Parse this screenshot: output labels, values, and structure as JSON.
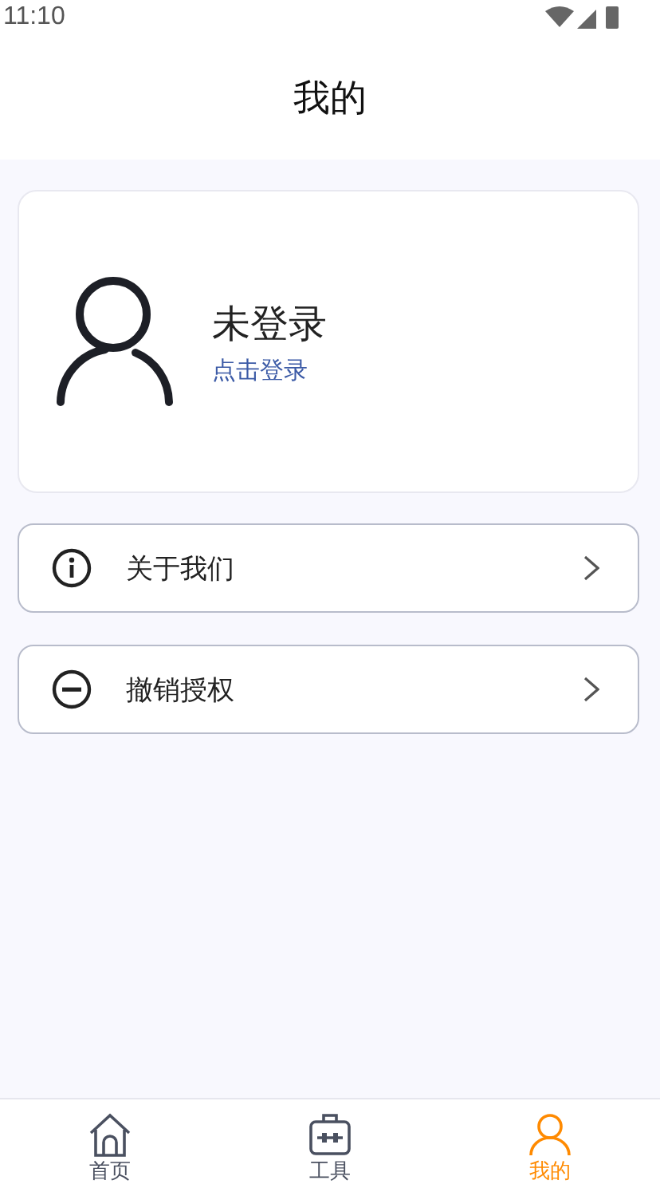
{
  "status_bar": {
    "time": "11:10"
  },
  "header": {
    "title": "我的"
  },
  "profile": {
    "name": "未登录",
    "action": "点击登录"
  },
  "menu": [
    {
      "kind": "info",
      "label": "关于我们"
    },
    {
      "kind": "minus",
      "label": "撤销授权"
    }
  ],
  "tabs": [
    {
      "kind": "home",
      "label": "首页",
      "selected": false
    },
    {
      "kind": "tools",
      "label": "工具",
      "selected": false
    },
    {
      "kind": "person",
      "label": "我的",
      "selected": true
    }
  ]
}
